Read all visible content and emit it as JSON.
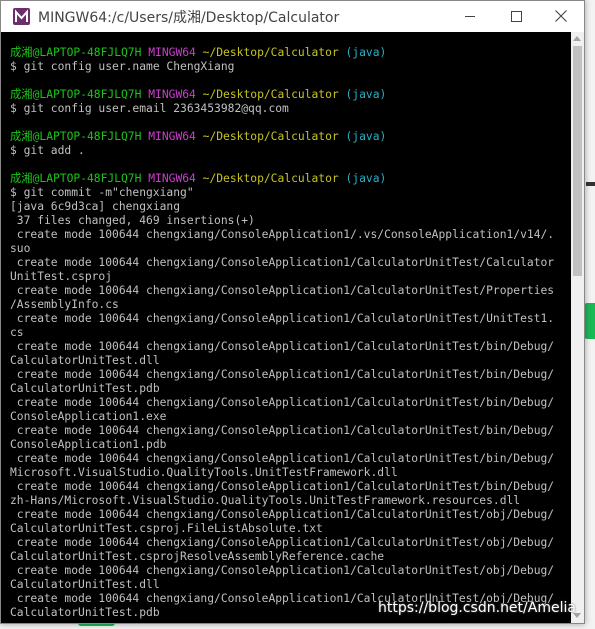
{
  "window": {
    "title": "MINGW64:/c/Users/成湘/Desktop/Calculator",
    "icon": "mingw-icon"
  },
  "prompt": {
    "user": "成湘@LAPTOP-48FJLQ7H",
    "host": "MINGW64",
    "path": "~/Desktop/Calculator",
    "branch": "(java)"
  },
  "terminal_lines": [
    {
      "kind": "prompt"
    },
    {
      "kind": "text",
      "text": "$ git config user.name ChengXiang"
    },
    {
      "kind": "blank"
    },
    {
      "kind": "prompt"
    },
    {
      "kind": "text",
      "text": "$ git config user.email 2363453982@qq.com"
    },
    {
      "kind": "blank"
    },
    {
      "kind": "prompt"
    },
    {
      "kind": "text",
      "text": "$ git add ."
    },
    {
      "kind": "blank"
    },
    {
      "kind": "prompt"
    },
    {
      "kind": "text",
      "text": "$ git commit -m\"chengxiang\""
    },
    {
      "kind": "text",
      "text": "[java 6c9d3ca] chengxiang"
    },
    {
      "kind": "text",
      "text": " 37 files changed, 469 insertions(+)"
    },
    {
      "kind": "text",
      "text": " create mode 100644 chengxiang/ConsoleApplication1/.vs/ConsoleApplication1/v14/."
    },
    {
      "kind": "text",
      "text": "suo"
    },
    {
      "kind": "text",
      "text": " create mode 100644 chengxiang/ConsoleApplication1/CalculatorUnitTest/Calculator"
    },
    {
      "kind": "text",
      "text": "UnitTest.csproj"
    },
    {
      "kind": "text",
      "text": " create mode 100644 chengxiang/ConsoleApplication1/CalculatorUnitTest/Properties"
    },
    {
      "kind": "text",
      "text": "/AssemblyInfo.cs"
    },
    {
      "kind": "text",
      "text": " create mode 100644 chengxiang/ConsoleApplication1/CalculatorUnitTest/UnitTest1."
    },
    {
      "kind": "text",
      "text": "cs"
    },
    {
      "kind": "text",
      "text": " create mode 100644 chengxiang/ConsoleApplication1/CalculatorUnitTest/bin/Debug/"
    },
    {
      "kind": "text",
      "text": "CalculatorUnitTest.dll"
    },
    {
      "kind": "text",
      "text": " create mode 100644 chengxiang/ConsoleApplication1/CalculatorUnitTest/bin/Debug/"
    },
    {
      "kind": "text",
      "text": "CalculatorUnitTest.pdb"
    },
    {
      "kind": "text",
      "text": " create mode 100644 chengxiang/ConsoleApplication1/CalculatorUnitTest/bin/Debug/"
    },
    {
      "kind": "text",
      "text": "ConsoleApplication1.exe"
    },
    {
      "kind": "text",
      "text": " create mode 100644 chengxiang/ConsoleApplication1/CalculatorUnitTest/bin/Debug/"
    },
    {
      "kind": "text",
      "text": "ConsoleApplication1.pdb"
    },
    {
      "kind": "text",
      "text": " create mode 100644 chengxiang/ConsoleApplication1/CalculatorUnitTest/bin/Debug/"
    },
    {
      "kind": "text",
      "text": "Microsoft.VisualStudio.QualityTools.UnitTestFramework.dll"
    },
    {
      "kind": "text",
      "text": " create mode 100644 chengxiang/ConsoleApplication1/CalculatorUnitTest/bin/Debug/"
    },
    {
      "kind": "text",
      "text": "zh-Hans/Microsoft.VisualStudio.QualityTools.UnitTestFramework.resources.dll"
    },
    {
      "kind": "text",
      "text": " create mode 100644 chengxiang/ConsoleApplication1/CalculatorUnitTest/obj/Debug/"
    },
    {
      "kind": "text",
      "text": "CalculatorUnitTest.csproj.FileListAbsolute.txt"
    },
    {
      "kind": "text",
      "text": " create mode 100644 chengxiang/ConsoleApplication1/CalculatorUnitTest/obj/Debug/"
    },
    {
      "kind": "text",
      "text": "CalculatorUnitTest.csprojResolveAssemblyReference.cache"
    },
    {
      "kind": "text",
      "text": " create mode 100644 chengxiang/ConsoleApplication1/CalculatorUnitTest/obj/Debug/"
    },
    {
      "kind": "text",
      "text": "CalculatorUnitTest.dll"
    },
    {
      "kind": "text",
      "text": " create mode 100644 chengxiang/ConsoleApplication1/CalculatorUnitTest/obj/Debug/"
    },
    {
      "kind": "text",
      "text": "CalculatorUnitTest.pdb"
    }
  ],
  "watermark": "https://blog.csdn.net/Amelia",
  "colors": {
    "terminal_bg": "#000000",
    "terminal_text": "#c0c0c0",
    "prompt_user": "#19c519",
    "prompt_host": "#cf3ccf",
    "prompt_path": "#c5c51c",
    "prompt_branch": "#28b0c6"
  }
}
